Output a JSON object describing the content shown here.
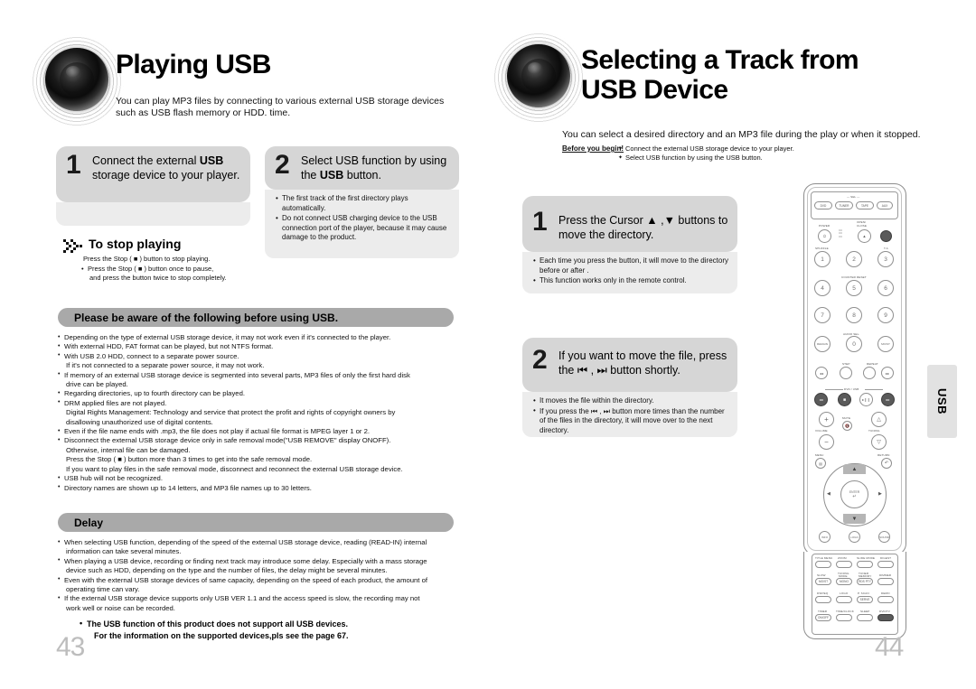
{
  "left_page": {
    "logo_name": "speaker-logo",
    "title": "Playing USB",
    "intro": "You can play MP3 files by connecting to various external USB storage devices such as USB flash memory or HDD. time.",
    "steps": [
      {
        "number": "1",
        "text": "Connect the external USB storage device to your player.",
        "text_pre": "Connect the external ",
        "text_bold": "USB",
        "text_post": " storage device to your player.",
        "notes": []
      },
      {
        "number": "2",
        "text": "Select USB function by using the USB button.",
        "text_pre": "Select USB function by using the ",
        "text_bold": "USB",
        "text_post": " button.",
        "notes": [
          "The first track of the first directory plays automatically.",
          "Do not connect USB charging device to the USB connection port of the player, because it may cause damage to the product."
        ]
      }
    ],
    "stop_playing": {
      "icon": "checkered-chevron-icon",
      "title": "To stop playing",
      "line1": "Press the Stop ( ■ ) button to stop playing.",
      "line2": "Press the Stop ( ■ ) button once to pause,",
      "line3": "and press the button twice to stop completely."
    },
    "aware_bar": "Please be aware of the following before using USB.",
    "aware_items": [
      {
        "bullet": true,
        "text": "Depending on the type of external USB storage device, it may not work even if it's connected to the player."
      },
      {
        "bullet": true,
        "text": "With external HDD, FAT format can be played, but not NTFS format."
      },
      {
        "bullet": true,
        "text": "With USB 2.0 HDD, connect to a separate power source."
      },
      {
        "bullet": false,
        "text": "If it's not connected to a separate power source, it may not work."
      },
      {
        "bullet": true,
        "text": "If memory of an external USB storage device is segmented into several parts, MP3 files of only the first hard disk"
      },
      {
        "bullet": false,
        "text": "drive can be played."
      },
      {
        "bullet": true,
        "text": "Regarding directories, up to fourth directory can be played."
      },
      {
        "bullet": true,
        "text": "DRM applied files are not played."
      },
      {
        "bullet": false,
        "text": "Digital Rights Management: Technology and service that protect the profit and rights of copyright owners by"
      },
      {
        "bullet": false,
        "text": "disallowing unauthorized use of digital contents."
      },
      {
        "bullet": true,
        "text": "Even if the file name ends with .mp3, the file does not play if actual file format is MPEG layer 1 or 2."
      },
      {
        "bullet": true,
        "text": "Disconnect the external USB storage device only in safe removal mode(\"USB REMOVE\" display ONOFF)."
      },
      {
        "bullet": false,
        "text": "Otherwise, internal file can be damaged."
      },
      {
        "bullet": false,
        "text": "Press the Stop ( ■ ) button more than 3 times to get into the safe removal mode."
      },
      {
        "bullet": false,
        "text": "If you want to play files in the safe removal mode, disconnect and reconnect the external USB storage device."
      },
      {
        "bullet": true,
        "text": "USB hub will not be recognized."
      },
      {
        "bullet": true,
        "text": "Directory names are shown up to 14 letters, and MP3 file names up to 30 letters."
      }
    ],
    "delay_bar": "Delay",
    "delay_items": [
      {
        "bullet": true,
        "text": "When selecting USB function, depending of the speed of the external USB storage device, reading (READ-IN) internal"
      },
      {
        "bullet": false,
        "text": "information can take several minutes."
      },
      {
        "bullet": true,
        "text": "When playing a USB device, recording or finding next track may introduce some delay. Especially with a mass storage"
      },
      {
        "bullet": false,
        "text": "device such as HDD, depending on the type and the number of files, the delay might be several minutes."
      },
      {
        "bullet": true,
        "text": "Even with the external USB storage devices of same capacity, depending on the speed of each product, the amount of"
      },
      {
        "bullet": false,
        "text": "operating time can vary."
      },
      {
        "bullet": true,
        "text": "If the external USB storage device supports only USB VER 1.1 and the access speed is slow, the recording may not"
      },
      {
        "bullet": false,
        "text": "work well or noise can be recorded."
      }
    ],
    "footnote_line1": "The USB function  of this product does not support all USB devices.",
    "footnote_line2": "For the information  on the supported devices,pls see the page  67.",
    "page_number": "43"
  },
  "right_page": {
    "logo_name": "speaker-logo",
    "title": "Selecting a Track from USB Device",
    "intro": "You can select a desired directory and an MP3 file during the play or when it stopped.",
    "before_you_begin": {
      "label": "Before you begin!",
      "items": [
        "Connect the external USB storage device to your player.",
        "Select USB function by using the USB button."
      ]
    },
    "steps": [
      {
        "number": "1",
        "text": "Press the Cursor ▲ ,▼ buttons to move the directory.",
        "notes": [
          "Each time you press the button, it will move to the directory before or after .",
          "This function works only in the remote control."
        ]
      },
      {
        "number": "2",
        "text": "If you want to move the file, press the ⏮ , ⏭ button shortly.",
        "notes": [
          "It moves the file within the directory.",
          "If you press the ⏮ , ⏭ button more times than the number of the files in the directory, it will move over to the next directory."
        ]
      }
    ],
    "side_tab": "USB",
    "page_number": "44"
  },
  "remote": {
    "name": "remote-control-illustration",
    "source_label": "— SEL —",
    "source_buttons": [
      "DVD",
      "TUNER",
      "TAPE",
      "AUX"
    ],
    "power_label": "POWER",
    "open_close_label": "OPEN/ CLOSE",
    "shuffle_label": "SHUFFLE",
    "ta_label": "T.A",
    "counter_reset_label": "COUNTER RESET",
    "audio_sel_label": "AUDIO SEL.",
    "keypad": [
      "1",
      "2",
      "3",
      "4",
      "5",
      "6",
      "7",
      "8",
      "9"
    ],
    "zero_key": "0",
    "remain_key": "REMAIN",
    "mo_st_key": "MO/ST",
    "step_label": "STEP",
    "repeat_label": "REPEAT",
    "dvd_usb_label": "DVD / USB",
    "volume_label": "VOLUME",
    "mute_label": "MUTE",
    "tuning_label": "TUNING",
    "menu_label": "MENU",
    "return_label": "RETURN",
    "enter_label": "ENTER",
    "info_label": "INFO",
    "logo_label": "LOGO",
    "sound_label": "SOUND",
    "bottom_grid": [
      [
        "TITLE MENU",
        "ZOOM",
        "SLIDE MODE",
        "DIGEST"
      ],
      [
        "SLOW\nMO/ST",
        "TUNING MODE\nMONO",
        "TUNER MEMORY\nRDS PTY",
        "DIMMER"
      ],
      [
        "DSP/EQ",
        "LOGO",
        "P. SCAN\nSERVE",
        "DEMO"
      ],
      [
        "TIMER\nON/OFF",
        "TIME/CLOCK",
        "SLEEP",
        "DVD/TV"
      ]
    ]
  }
}
